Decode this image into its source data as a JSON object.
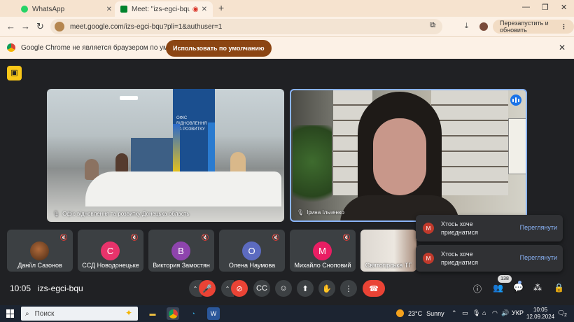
{
  "browser": {
    "tabs": [
      {
        "label": "WhatsApp",
        "favicon_color": "#25d366"
      },
      {
        "label": "Meet: \"izs-egci-bqu\"",
        "favicon_color": "#00832d"
      }
    ],
    "new_tab": "+",
    "address": "meet.google.com/izs-egci-bqu?pli=1&authuser=1",
    "relaunch_button": "Перезапустить и обновить",
    "infobar": {
      "message": "Google Chrome не является браузером по умолчанию.",
      "button": "Использовать по умолчанию"
    }
  },
  "meet": {
    "main_tiles": [
      {
        "name": "Офіс відновлення та розвитку Донецька область"
      },
      {
        "name": "Ірина Ільченко"
      }
    ],
    "office_wall_text": "ОФІС ВІДНОВЛЕННЯ ТА РОЗВИТКУ",
    "participants": [
      {
        "name": "Даніїл Сазонов",
        "initial": "",
        "color": "#7a4a2a"
      },
      {
        "name": "ССД Новодонецьке",
        "initial": "С",
        "color": "#e8336b"
      },
      {
        "name": "Виктория Замостян",
        "initial": "В",
        "color": "#8e44ad"
      },
      {
        "name": "Олена Наумова",
        "initial": "О",
        "color": "#5c6bc0"
      },
      {
        "name": "Михайло Сноповий",
        "initial": "М",
        "color": "#e91e63"
      },
      {
        "name": "Святогірська ТГ",
        "initial": "",
        "color": "#d9d4cc"
      }
    ],
    "join_requests": [
      {
        "avatar": "M",
        "text": "Хтось хоче приєднатися",
        "action": "Переглянути"
      },
      {
        "avatar": "M",
        "text": "Хтось хоче приєднатися",
        "action": "Переглянути"
      }
    ],
    "time": "10:05",
    "meeting_code": "izs-egci-bqu",
    "people_count": "138"
  },
  "taskbar": {
    "search_placeholder": "Поиск",
    "weather_temp": "23°C",
    "weather_text": "Sunny",
    "language": "УКР",
    "time": "10:05",
    "date": "12.09.2024",
    "notification_count": "2"
  }
}
